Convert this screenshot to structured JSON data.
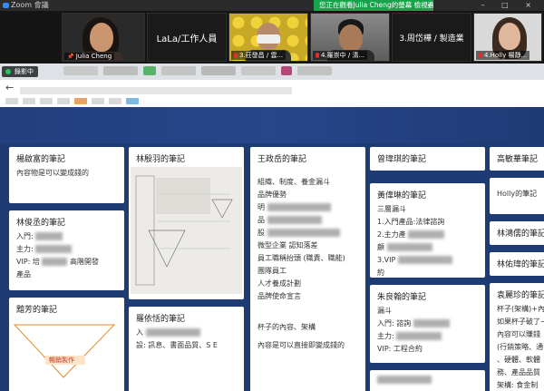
{
  "titlebar": {
    "app": "Zoom 會議",
    "view_banner": "您正在觀看Julia Cheng的螢幕",
    "view_options": "檢視選項",
    "window_controls": "– □ ×"
  },
  "participants": [
    {
      "name": "Julia Cheng"
    },
    {
      "display_text": "LaLa/工作人員"
    },
    {
      "name": "3.莊發昌 / 雲..."
    },
    {
      "name": "4.羅崇中 / 清..."
    },
    {
      "display_text": "3.周岱樺 / 製造業"
    },
    {
      "name": "4.Holly 楊靜..."
    }
  ],
  "browser": {
    "share_indicator": "錄影中",
    "back_icon": "←"
  },
  "board": {
    "columns": [
      {
        "cards": [
          {
            "title": "楊啟富的筆記",
            "lines": [
              "內容物是可以變成錢的"
            ]
          },
          {
            "title": "林俊丞的筆記",
            "lines": [
              "入門:",
              "主力:",
              "VIP: 培",
              "產品"
            ],
            "blur_hint": "高階開發"
          },
          {
            "title": "黯芳的筆記",
            "lines": [],
            "diagram_label": "暢銷製作"
          }
        ]
      },
      {
        "cards": [
          {
            "title": "林殷羽的筆記",
            "lines": []
          },
          {
            "title": "羅依恬的筆記",
            "lines": [
              "入",
              "設: 訊息、書面品質、S E"
            ]
          }
        ]
      },
      {
        "cards": [
          {
            "title": "王政岳的筆記",
            "lines": [
              "組織、制度、養金漏斗",
              "品牌優勢",
              "明",
              "品",
              "股",
              "微型企業 認知落差",
              "員工職稱抬頭 (職責、職能)",
              "團隊員工",
              "人才養成計劃",
              "品牌使命宣言",
              "杯子的內容、架構",
              "內容是可以直接即變成錢的"
            ]
          }
        ]
      },
      {
        "cards": [
          {
            "title": "曾瑋琪的筆記",
            "lines": []
          },
          {
            "title": "黃偉琳的筆記",
            "lines": [
              "三層漏斗",
              "1.入門產品:法律諮詢",
              "2.主力產",
              "顧",
              "3.VIP",
              "約"
            ]
          },
          {
            "title": "朱良翰的筆記",
            "lines": [
              "漏斗",
              "入門: 諮詢",
              "主力:",
              "VIP: 工程合約"
            ]
          },
          {
            "title": "",
            "lines": []
          }
        ]
      },
      {
        "cards": [
          {
            "title": "高敏華筆記",
            "lines": []
          },
          {
            "title": "",
            "lines": [
              "Holly的筆記"
            ]
          },
          {
            "title": "林鴻儒的筆記",
            "lines": []
          },
          {
            "title": "林佑瑋的筆記",
            "lines": []
          },
          {
            "title": "袁麗珍的筆記",
            "lines": [
              "杯子(架構)+內",
              "如果杯子破了~",
              "內容可以賺錢",
              "(行銷策略、通",
              "、硬體、軟體",
              "務、產品品質",
              "架構: 食金制"
            ]
          }
        ]
      }
    ]
  },
  "colors": {
    "board_bg": "#1f3b73",
    "banner": "#17a34a",
    "titlebar": "#2b2b2b"
  }
}
